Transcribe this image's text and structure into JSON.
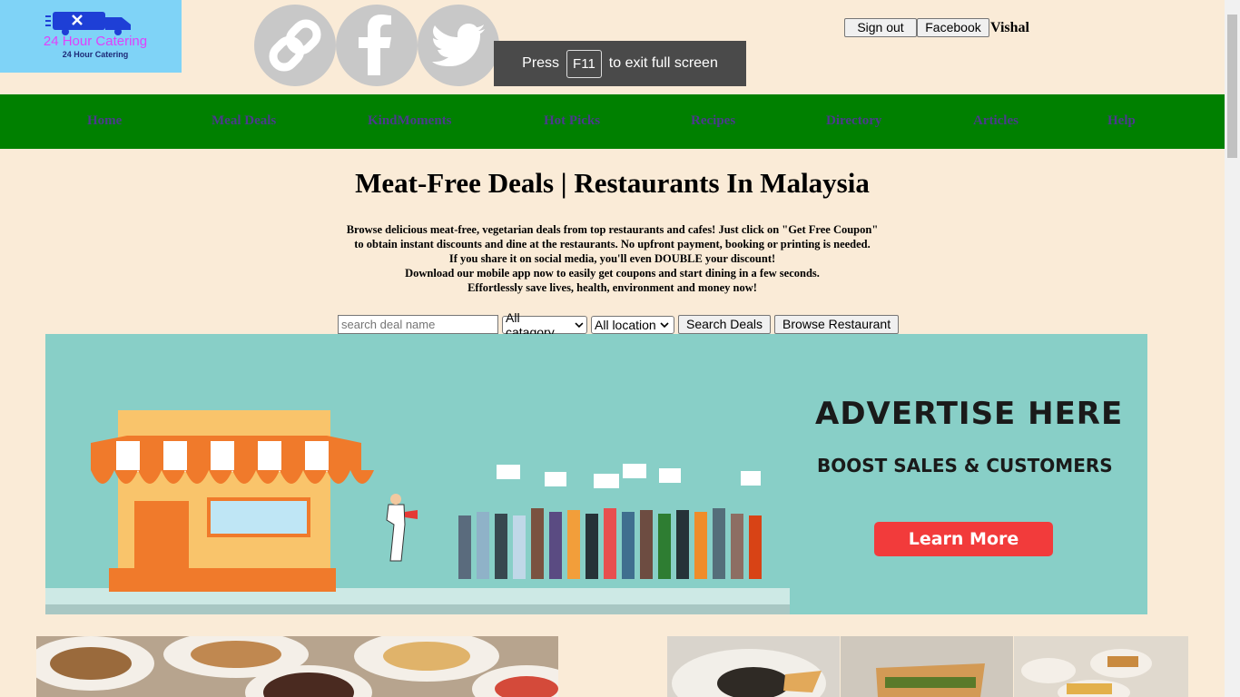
{
  "logo": {
    "brand": "24 Hour Catering",
    "tagline": "24 Hour Catering"
  },
  "share_icons": [
    "link-icon",
    "facebook-icon",
    "twitter-icon"
  ],
  "fullscreen_toast": {
    "before": "Press",
    "key": "F11",
    "after": "to exit full screen"
  },
  "account": {
    "sign_out": "Sign out",
    "facebook": "Facebook",
    "user": "Vishal"
  },
  "nav": [
    "Home",
    "Meal Deals",
    "KindMoments",
    "Hot Picks",
    "Recipes",
    "Directory",
    "Articles",
    "Help"
  ],
  "headline": "Meat-Free Deals | Restaurants In Malaysia",
  "intro": [
    "Browse delicious meat-free, vegetarian deals from top restaurants and cafes! Just click on \"Get Free Coupon\"",
    "to obtain instant discounts and dine at the restaurants. No upfront payment, booking or printing is needed.",
    "If you share it on social media, you'll even DOUBLE your discount!",
    "Download our mobile app now to easily get coupons and start dining in a few seconds.",
    "Effortlessly save lives, health, environment and money now!"
  ],
  "search": {
    "placeholder": "search deal name",
    "category": "All catagory",
    "location": "All location",
    "search_button": "Search Deals",
    "browse_button": "Browse Restaurant"
  },
  "banner": {
    "title": "ADVERTISE HERE",
    "subtitle": "BOOST SALES & CUSTOMERS",
    "cta": "Learn More"
  },
  "colors": {
    "background": "#faebd7",
    "nav": "#008000",
    "nav_text": "#4b3a8c",
    "banner": "#88cfc7",
    "cta": "#f23b3b"
  }
}
